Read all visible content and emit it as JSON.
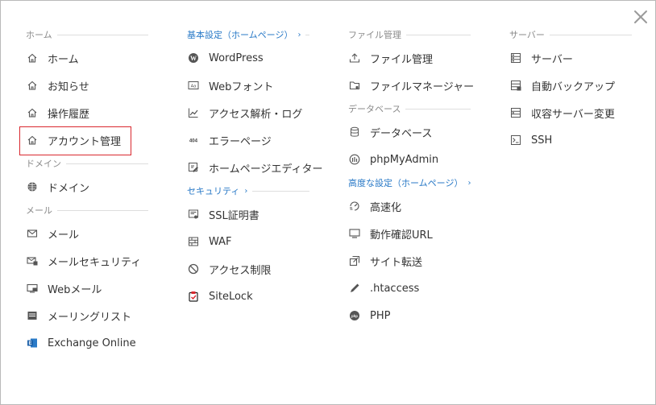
{
  "columns": [
    {
      "sections": [
        {
          "title": "ホーム",
          "link": false,
          "items": [
            {
              "label": "ホーム",
              "icon": "home-icon"
            },
            {
              "label": "お知らせ",
              "icon": "home-icon"
            },
            {
              "label": "操作履歴",
              "icon": "home-icon"
            },
            {
              "label": "アカウント管理",
              "icon": "home-icon",
              "selected": true
            }
          ]
        },
        {
          "title": "ドメイン",
          "link": false,
          "items": [
            {
              "label": "ドメイン",
              "icon": "globe-icon"
            }
          ]
        },
        {
          "title": "メール",
          "link": false,
          "items": [
            {
              "label": "メール",
              "icon": "mail-icon"
            },
            {
              "label": "メールセキュリティ",
              "icon": "mail-security-icon"
            },
            {
              "label": "Webメール",
              "icon": "webmail-icon"
            },
            {
              "label": "メーリングリスト",
              "icon": "mailing-list-icon"
            },
            {
              "label": "Exchange Online",
              "icon": "exchange-icon"
            }
          ]
        }
      ]
    },
    {
      "sections": [
        {
          "title": "基本設定（ホームページ）",
          "link": true,
          "items": [
            {
              "label": "WordPress",
              "icon": "wordpress-icon"
            },
            {
              "label": "Webフォント",
              "icon": "webfont-icon"
            },
            {
              "label": "アクセス解析・ログ",
              "icon": "analytics-icon"
            },
            {
              "label": "エラーページ",
              "icon": "error-404-icon"
            },
            {
              "label": "ホームページエディター",
              "icon": "editor-icon"
            }
          ]
        },
        {
          "title": "セキュリティ",
          "link": true,
          "items": [
            {
              "label": "SSL証明書",
              "icon": "certificate-icon"
            },
            {
              "label": "WAF",
              "icon": "firewall-icon"
            },
            {
              "label": "アクセス制限",
              "icon": "prohibited-icon"
            },
            {
              "label": "SiteLock",
              "icon": "sitelock-icon"
            }
          ]
        }
      ]
    },
    {
      "sections": [
        {
          "title": "ファイル管理",
          "link": false,
          "items": [
            {
              "label": "ファイル管理",
              "icon": "upload-icon"
            },
            {
              "label": "ファイルマネージャー",
              "icon": "folder-icon"
            }
          ]
        },
        {
          "title": "データベース",
          "link": false,
          "items": [
            {
              "label": "データベース",
              "icon": "database-icon"
            },
            {
              "label": "phpMyAdmin",
              "icon": "phpmyadmin-icon"
            }
          ]
        },
        {
          "title": "高度な設定（ホームページ）",
          "link": true,
          "items": [
            {
              "label": "高速化",
              "icon": "speed-icon"
            },
            {
              "label": "動作確認URL",
              "icon": "monitor-icon"
            },
            {
              "label": "サイト転送",
              "icon": "transfer-icon"
            },
            {
              "label": ".htaccess",
              "icon": "pen-icon"
            },
            {
              "label": "PHP",
              "icon": "php-icon"
            }
          ]
        }
      ]
    },
    {
      "sections": [
        {
          "title": "サーバー",
          "link": false,
          "items": [
            {
              "label": "サーバー",
              "icon": "server-icon"
            },
            {
              "label": "自動バックアップ",
              "icon": "backup-icon"
            },
            {
              "label": "収容サーバー変更",
              "icon": "server-change-icon"
            },
            {
              "label": "SSH",
              "icon": "terminal-icon"
            }
          ]
        }
      ]
    }
  ],
  "colors": {
    "accent": "#2a7ac7",
    "selected_border": "#d9282f"
  }
}
